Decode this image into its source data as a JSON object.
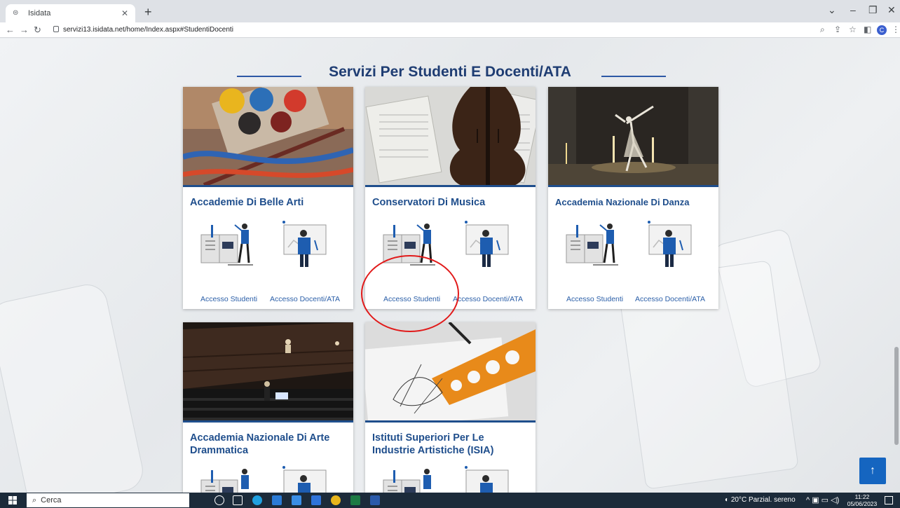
{
  "browser": {
    "tab_title": "Isidata",
    "new_tab": "+",
    "url": "servizi13.isidata.net/home/Index.aspx#StudentiDocenti"
  },
  "page": {
    "section_title": "Servizi Per Studenti E Docenti/ATA",
    "cards": [
      {
        "title": "Accademie Di Belle Arti",
        "students": "Accesso Studenti",
        "teachers": "Accesso Docenti/ATA"
      },
      {
        "title": "Conservatori Di Musica",
        "students": "Accesso Studenti",
        "teachers": "Accesso Docenti/ATA"
      },
      {
        "title": "Accademia Nazionale Di Danza",
        "students": "Accesso Studenti",
        "teachers": "Accesso Docenti/ATA"
      },
      {
        "title": "Accademia Nazionale Di Arte Drammatica"
      },
      {
        "title": "Istituti Superiori Per Le Industrie Artistiche (ISIA)"
      }
    ],
    "scroll_top_icon": "↑"
  },
  "taskbar": {
    "search_placeholder": "Cerca",
    "weather": "20°C Parzial. sereno",
    "time": "11:22",
    "date": "05/06/2023"
  },
  "colors": {
    "brand_blue": "#1f4e8c",
    "link_blue": "#2b5fa8",
    "highlight_red": "#e11a1a"
  }
}
